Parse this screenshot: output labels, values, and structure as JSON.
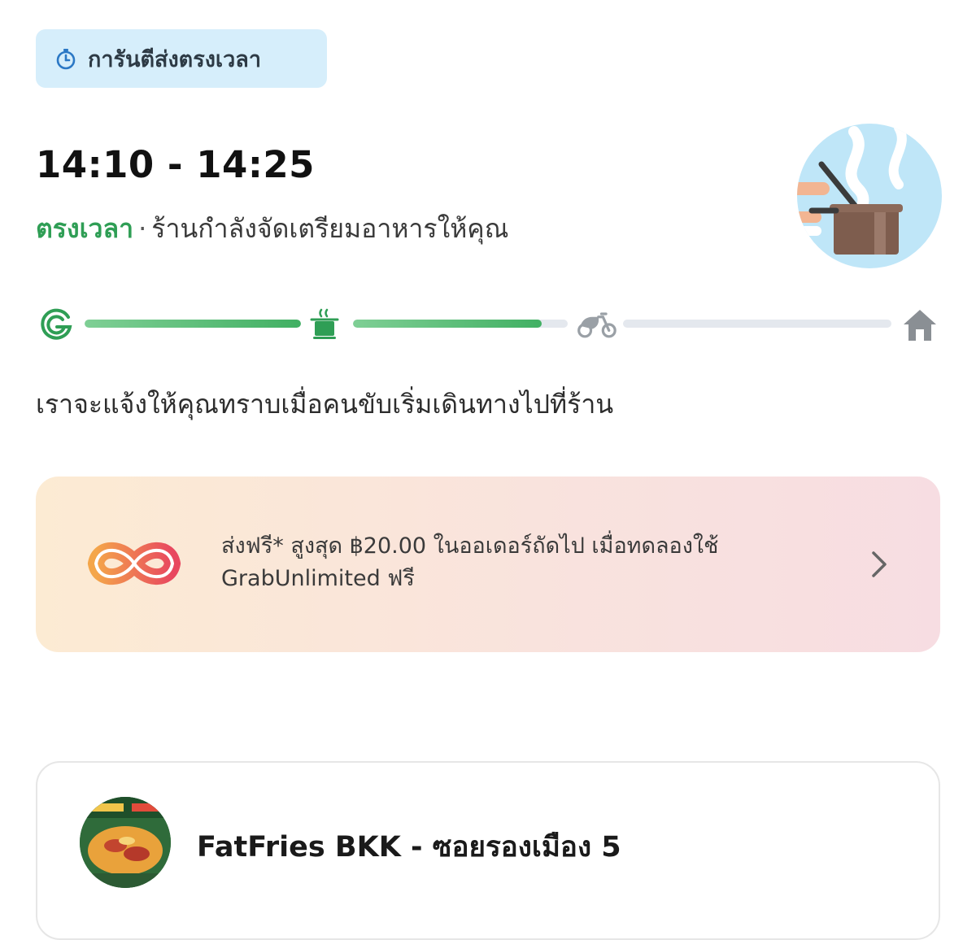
{
  "badge": {
    "label": "การันตีส่งตรงเวลา",
    "icon": "stopwatch-icon"
  },
  "eta": {
    "time_range": "14:10 - 14:25",
    "status": "ตรงเวลา",
    "separator": "·",
    "message": "ร้านกำลังจัดเตรียมอาหารให้คุณ"
  },
  "progress": {
    "steps": [
      {
        "icon": "grab-logo-icon",
        "state": "done"
      },
      {
        "icon": "cooking-pot-icon",
        "state": "active"
      },
      {
        "icon": "motorbike-icon",
        "state": "pending"
      },
      {
        "icon": "home-icon",
        "state": "pending"
      }
    ],
    "segments_fill": [
      1.0,
      0.88,
      0.0
    ]
  },
  "notice": "เราจะแจ้งให้คุณทราบเมื่อคนขับเริ่มเดินทางไปที่ร้าน",
  "promo": {
    "text": "ส่งฟรี* สูงสุด ฿20.00 ในออเดอร์ถัดไป เมื่อทดลองใช้ GrabUnlimited ฟรี",
    "icon": "grabunlimited-icon"
  },
  "store": {
    "name": "FatFries BKK - ซอยรองเมือง 5"
  },
  "colors": {
    "accent_green": "#2f9e55",
    "badge_bg": "#d6eefb",
    "track_grey": "#e4e8ee"
  }
}
